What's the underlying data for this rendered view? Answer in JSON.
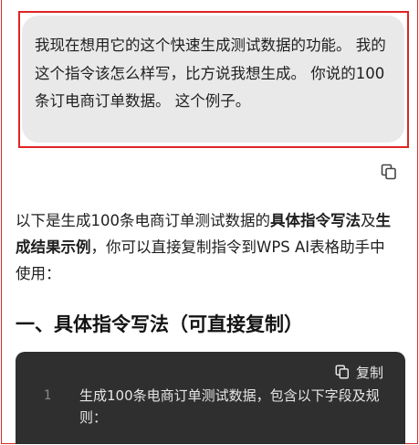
{
  "user_message": {
    "text": "我现在想用它的这个快速生成测试数据的功能。 我的这个指令该怎么样写，比方说我想生成。 你说的100条订电商订单数据。 这个例子。"
  },
  "assistant": {
    "intro_part1": "以下是生成100条电商订单测试数据的",
    "intro_bold1": "具体指令写法",
    "intro_part2": "及",
    "intro_bold2": "生成结果示例",
    "intro_part3": "，你可以直接复制指令到WPS AI表格助手中使用：",
    "section_title": "一、具体指令写法（可直接复制）",
    "code_block": {
      "copy_label": "复制",
      "line_number": "1",
      "line_text": "生成100条电商订单测试数据，包含以下字段及规则："
    }
  },
  "icons": {
    "copy_message": "copy-icon",
    "copy_code": "copy-icon"
  },
  "colors": {
    "highlight_border": "#e02424",
    "user_bubble_bg": "#e9e9e9",
    "code_bg": "#2f2f2f"
  }
}
